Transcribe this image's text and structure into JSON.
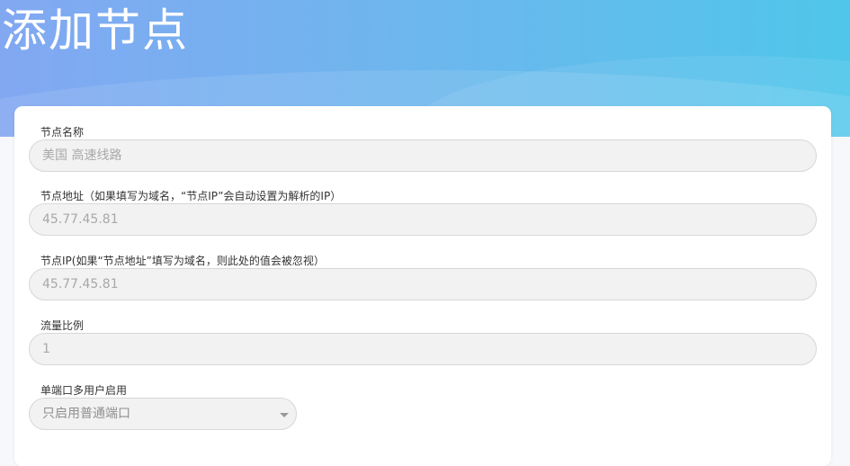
{
  "page": {
    "title": "添加节点"
  },
  "form": {
    "node_name": {
      "label": "节点名称",
      "placeholder": "美国 高速线路"
    },
    "node_address": {
      "label": "节点地址（如果填写为域名，“节点IP”会自动设置为解析的IP）",
      "placeholder": "45.77.45.81"
    },
    "node_ip": {
      "label": "节点IP(如果“节点地址”填写为域名，则此处的值会被忽视）",
      "placeholder": "45.77.45.81"
    },
    "traffic_ratio": {
      "label": "流量比例",
      "placeholder": "1"
    },
    "single_port": {
      "label": "单端口多用户启用",
      "selected": "只启用普通端口"
    }
  },
  "colors": {
    "header_gradient_start": "#82a8f2",
    "header_gradient_end": "#4fc6ea",
    "input_background": "#f2f2f2",
    "card_background": "#ffffff"
  }
}
